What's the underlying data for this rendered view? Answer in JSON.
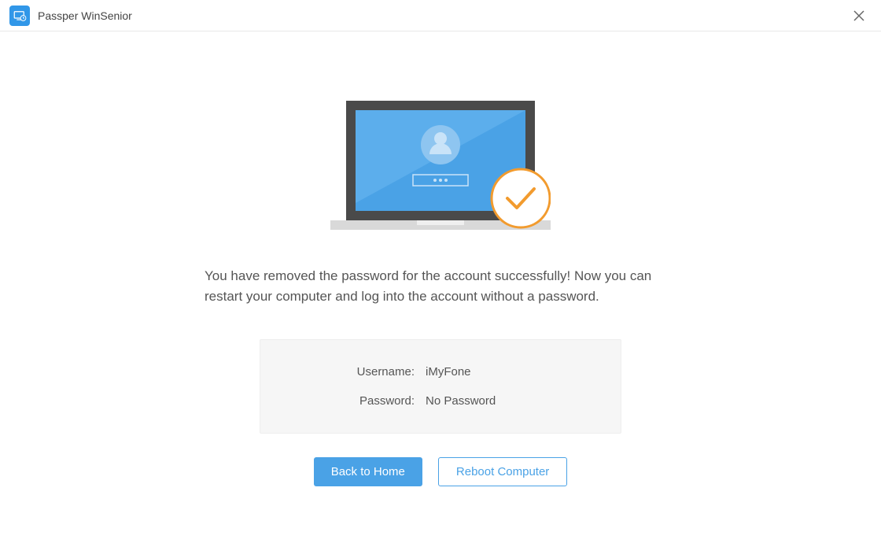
{
  "titlebar": {
    "app_name": "Passper WinSenior"
  },
  "main": {
    "message": "You have removed the password for the account successfully! Now you can restart your computer and log into the account without a password.",
    "info": {
      "username_label": "Username:",
      "username_value": "iMyFone",
      "password_label": "Password:",
      "password_value": "No Password"
    },
    "buttons": {
      "back_home": "Back to Home",
      "reboot": "Reboot Computer"
    }
  },
  "colors": {
    "accent": "#4aa2e6",
    "success": "#f29b2e"
  }
}
